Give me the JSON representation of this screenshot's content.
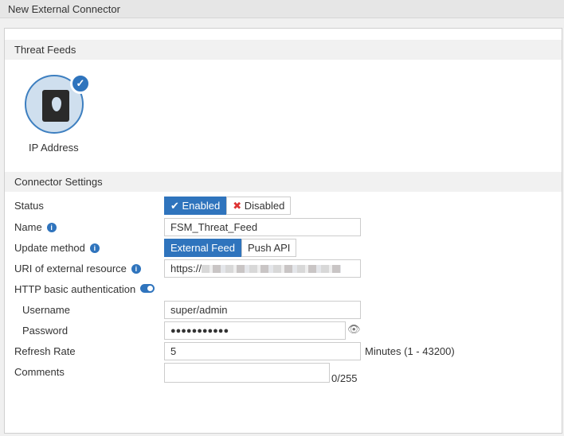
{
  "title": "New External Connector",
  "threat_feeds": {
    "header": "Threat Feeds",
    "item_label": "IP Address"
  },
  "settings": {
    "header": "Connector Settings",
    "status": {
      "label": "Status",
      "enabled": "Enabled",
      "disabled": "Disabled"
    },
    "name": {
      "label": "Name",
      "value": "FSM_Threat_Feed"
    },
    "update_method": {
      "label": "Update method",
      "options": [
        "External Feed",
        "Push API"
      ]
    },
    "uri": {
      "label": "URI of external resource",
      "value": "https://"
    },
    "http_auth": {
      "label": "HTTP basic authentication"
    },
    "username": {
      "label": "Username",
      "value": "super/admin"
    },
    "password": {
      "label": "Password",
      "value": "●●●●●●●●●●●"
    },
    "refresh": {
      "label": "Refresh Rate",
      "value": "5",
      "suffix": "Minutes (1 - 43200)"
    },
    "comments": {
      "label": "Comments",
      "value": "",
      "counter": "0/255"
    }
  }
}
